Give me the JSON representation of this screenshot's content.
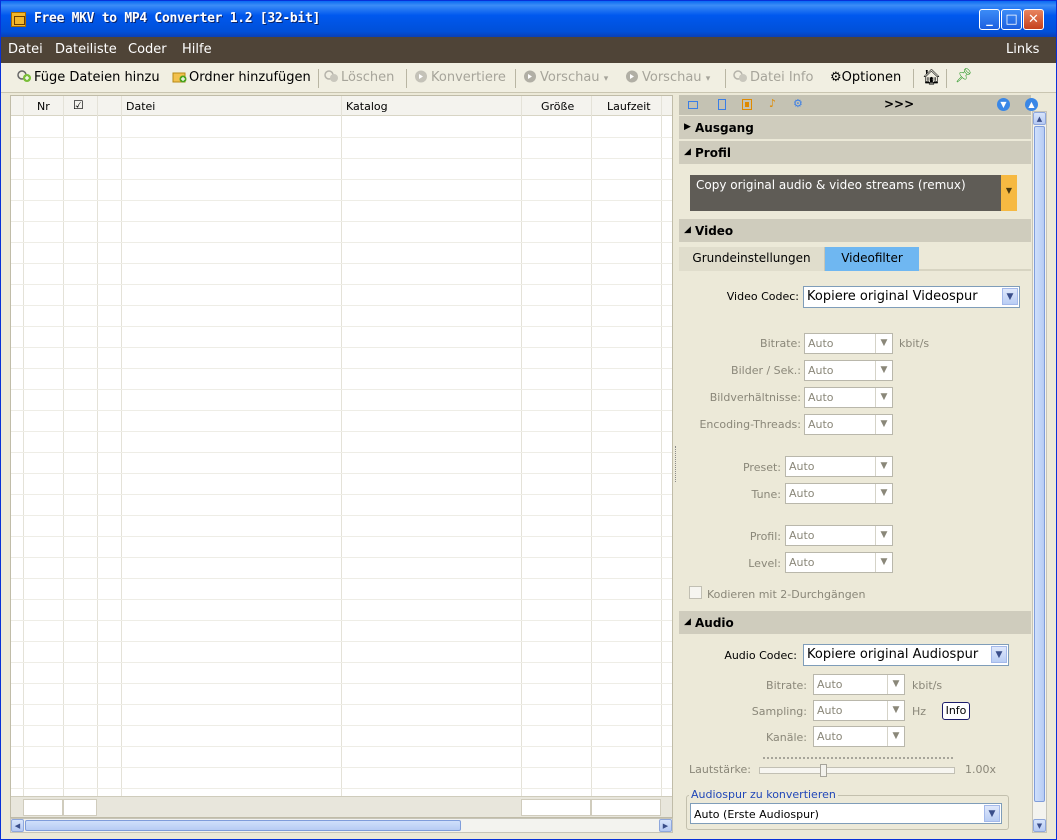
{
  "window": {
    "title": "Free MKV to MP4 Converter 1.2  [32-bit]",
    "min": "_",
    "max": "□",
    "close": "✕"
  },
  "menu": {
    "items": [
      "Datei",
      "Dateiliste",
      "Coder",
      "Hilfe"
    ],
    "right": "Links"
  },
  "toolbar": {
    "add_files": "Füge Dateien hinzu",
    "add_folder": "Ordner hinzufügen",
    "delete": "Löschen",
    "convert": "Konvertiere",
    "preview1": "Vorschau",
    "preview2": "Vorschau",
    "file_info": "Datei Info",
    "options": "Optionen"
  },
  "grid": {
    "columns": [
      "Nr",
      "☑",
      "",
      "Datei",
      "Katalog",
      "Größe",
      "Laufzeit"
    ]
  },
  "panel": {
    "more": ">>>",
    "sections": {
      "output": "Ausgang",
      "profile": "Profil",
      "video": "Video",
      "audio": "Audio"
    },
    "profile_value": "Copy original audio & video streams (remux)",
    "video_tabs": [
      "Grundeinstellungen",
      "Videofilter"
    ],
    "video": {
      "codec_label": "Video Codec:",
      "codec_value": "Kopiere original Videospur",
      "bitrate_label": "Bitrate:",
      "fps_label": "Bilder / Sek.:",
      "aspect_label": "Bildverhältnisse:",
      "threads_label": "Encoding-Threads:",
      "preset_label": "Preset:",
      "tune_label": "Tune:",
      "profile_label": "Profil:",
      "level_label": "Level:",
      "auto": "Auto",
      "kbits": "kbit/s",
      "twopass": "Kodieren mit 2-Durchgängen"
    },
    "audio": {
      "codec_label": "Audio Codec:",
      "codec_value": "Kopiere original Audiospur",
      "bitrate_label": "Bitrate:",
      "sampling_label": "Sampling:",
      "channels_label": "Kanäle:",
      "volume_label": "Lautstärke:",
      "volume_value": "1.00x",
      "auto": "Auto",
      "kbits": "kbit/s",
      "hz": "Hz",
      "info": "Info",
      "track_legend": "Audiospur zu konvertieren",
      "track_value": "Auto (Erste Audiospur)"
    }
  }
}
